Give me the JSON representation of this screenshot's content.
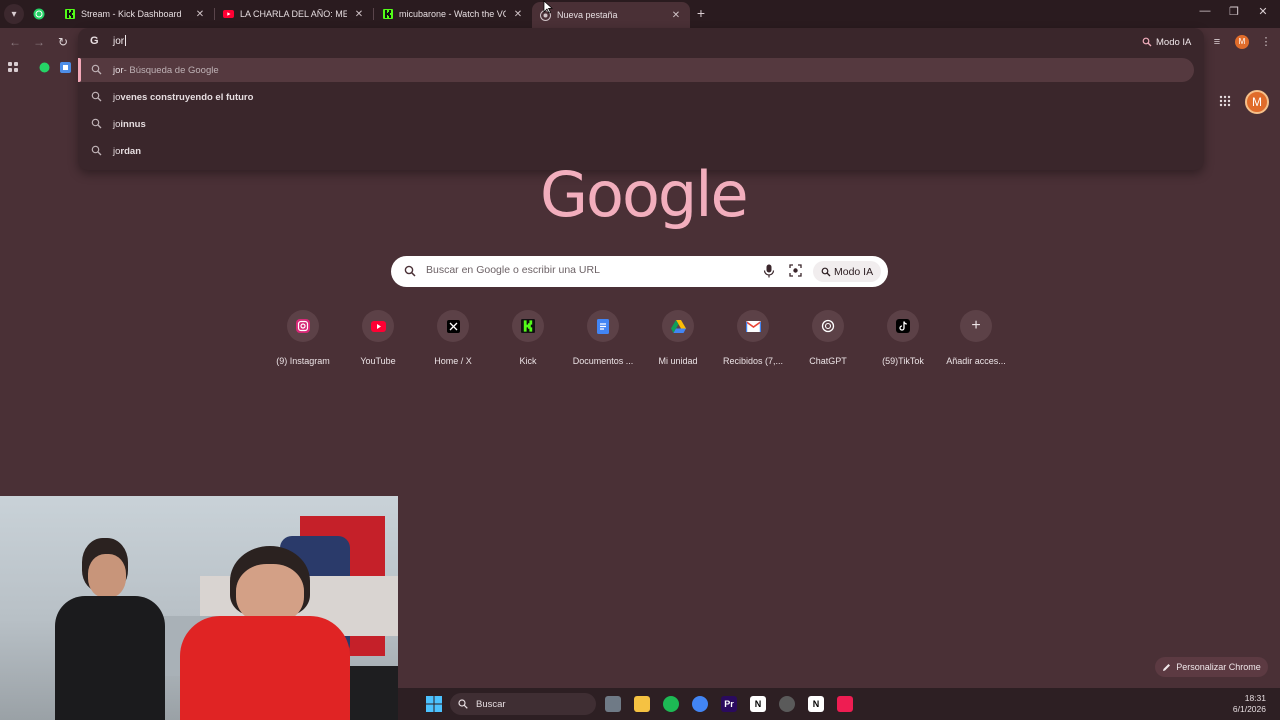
{
  "tabs": [
    {
      "title": "Stream - Kick Dashboard",
      "icon": "kick-icon"
    },
    {
      "title": "LA CHARLA DEL AÑO: MESSI E",
      "icon": "youtube-icon"
    },
    {
      "title": "micubarone - Watch the VOD o",
      "icon": "kick-icon"
    },
    {
      "title": "Nueva pestaña",
      "icon": "chrome-icon",
      "active": true
    }
  ],
  "omnibox": {
    "text": "jor",
    "suggestions": [
      {
        "typed": "jor",
        "completion": "",
        "suffix": " - Búsqueda de Google",
        "selected": true
      },
      {
        "typed": "jo",
        "completion": "venes construyendo el futuro"
      },
      {
        "typed": "jo",
        "completion": "innus"
      },
      {
        "typed": "jo",
        "completion": "rdan"
      }
    ]
  },
  "toolbar": {
    "modo_ia": "Modo IA",
    "profile_initial": "M"
  },
  "ntp": {
    "logo": "Google",
    "search_placeholder": "Buscar en Google o escribir una URL",
    "modo_ia": "Modo IA",
    "profile_initial": "M",
    "personalize": "Personalizar Chrome",
    "shortcuts": [
      {
        "label": "(9) Instagram",
        "icon": "instagram-icon"
      },
      {
        "label": "YouTube",
        "icon": "youtube-icon"
      },
      {
        "label": "Home / X",
        "icon": "x-icon"
      },
      {
        "label": "Kick",
        "icon": "kick-icon"
      },
      {
        "label": "Documentos ...",
        "icon": "docs-icon"
      },
      {
        "label": "Mi unidad",
        "icon": "drive-icon"
      },
      {
        "label": "Recibidos (7,...",
        "icon": "gmail-icon"
      },
      {
        "label": "ChatGPT",
        "icon": "chatgpt-icon"
      },
      {
        "label": "(59)TikTok",
        "icon": "tiktok-icon"
      },
      {
        "label": "Añadir acces...",
        "icon": "plus-icon"
      }
    ]
  },
  "taskbar": {
    "search": "Buscar",
    "time": "18:31",
    "date": "6/1/2026"
  },
  "colors": {
    "background": "#4a3036",
    "accent": "#f2aebd"
  }
}
